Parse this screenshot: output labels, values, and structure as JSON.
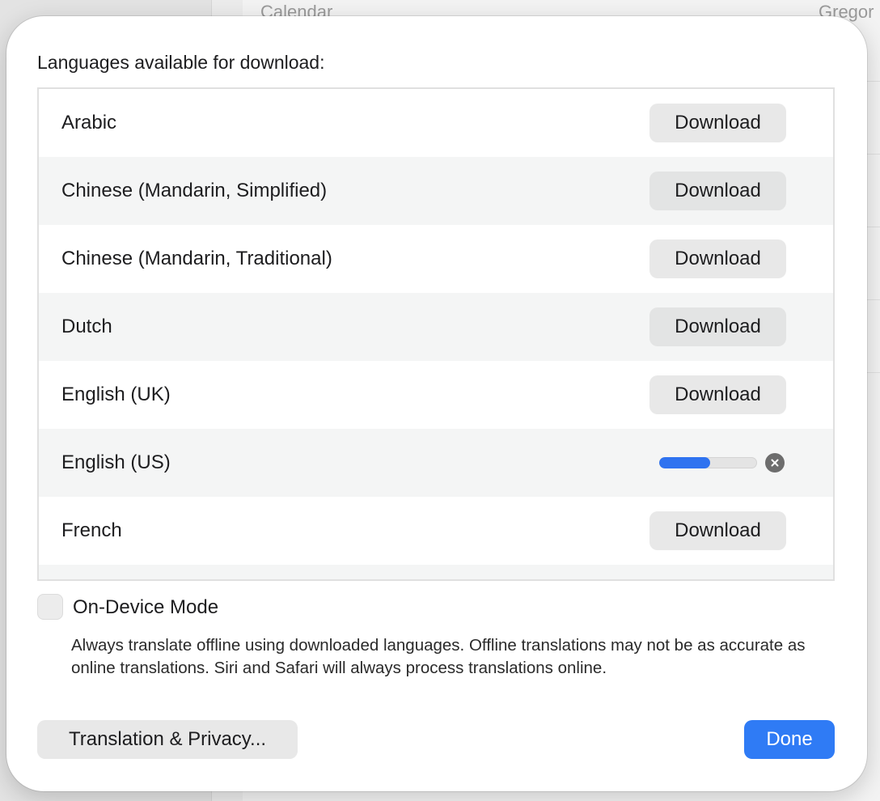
{
  "background": {
    "calendar_label": "Calendar",
    "calendar_value": "Gregor"
  },
  "sheet": {
    "heading": "Languages available for download:",
    "languages": [
      {
        "name": "Arabic",
        "action": "Download"
      },
      {
        "name": "Chinese (Mandarin, Simplified)",
        "action": "Download"
      },
      {
        "name": "Chinese (Mandarin, Traditional)",
        "action": "Download"
      },
      {
        "name": "Dutch",
        "action": "Download"
      },
      {
        "name": "English (UK)",
        "action": "Download"
      },
      {
        "name": "English (US)",
        "progress": 0.52
      },
      {
        "name": "French",
        "action": "Download"
      }
    ],
    "on_device_label": "On-Device Mode",
    "on_device_checked": false,
    "help_text": "Always translate offline using downloaded languages. Offline translations may not be as accurate as online translations. Siri and Safari will always process translations online.",
    "privacy_button": "Translation & Privacy...",
    "done_button": "Done"
  },
  "colors": {
    "accent": "#2f7bf5",
    "progress": "#2f73f0"
  }
}
